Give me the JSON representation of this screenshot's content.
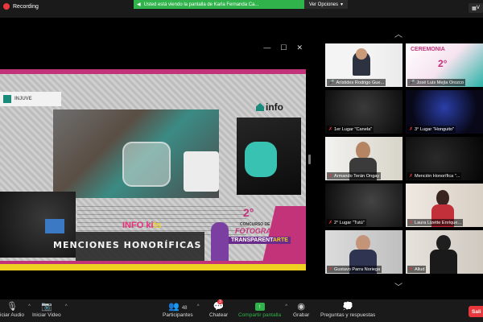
{
  "topbar": {
    "recording": "Recording",
    "share_banner": "Usted está viendo la pantalla de Karla Fernanda Ca...",
    "view_options": "Ver Opciones",
    "corner_label": "V"
  },
  "slide": {
    "logo_text": "INJUVE",
    "info_logo": "info",
    "info_kits_a": "INFO ki",
    "info_kits_b": "ts",
    "menciones": "MENCIONES HONORÍFICAS",
    "concurso": {
      "number": "2°",
      "line1": "CONCURSO DE",
      "line2": "FOTOGRAFÍA",
      "line3a": "TRANSPARENT",
      "line3b": "ARTE"
    }
  },
  "gallery": {
    "tiles": [
      {
        "name": "Arístides Rodrigo Gue...",
        "muted": false,
        "active": true
      },
      {
        "name": "José Luis Mejía Orozco",
        "muted": false,
        "active": false
      },
      {
        "name": "1er Lugar \"Canela\"",
        "muted": true,
        "active": false
      },
      {
        "name": "3° Lugar \"Honguito\"",
        "muted": true,
        "active": false
      },
      {
        "name": "Armando Terán Ongay",
        "muted": true,
        "active": false
      },
      {
        "name": "Mención Honorífica \"...",
        "muted": true,
        "active": false
      },
      {
        "name": "2° Lugar \"Tutú\"",
        "muted": true,
        "active": false
      },
      {
        "name": "Laura Lizette Enríque...",
        "muted": true,
        "active": false
      },
      {
        "name": "Gustavo Parra Noriega",
        "muted": true,
        "active": false
      },
      {
        "name": "Allud",
        "muted": true,
        "active": false
      }
    ]
  },
  "toolbar": {
    "audio": "iciar Audio",
    "video": "Iniciar Video",
    "participants": "Participantes",
    "participants_count": "48",
    "chat": "Chatear",
    "chat_badge": "3",
    "share": "Compartir pantalla",
    "record": "Grabar",
    "qa": "Preguntas y respuestas",
    "end": "Sali"
  },
  "colors": {
    "share_green": "#2fb34a",
    "active_border": "#b8e04a",
    "end_red": "#e8383d",
    "brand_magenta": "#c2337a"
  }
}
